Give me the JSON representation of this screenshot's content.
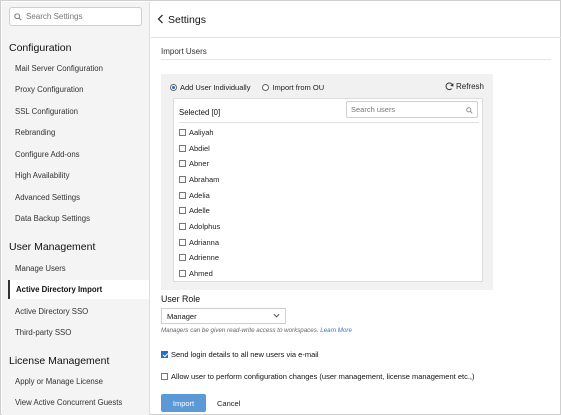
{
  "sidebar": {
    "search_placeholder": "Search Settings",
    "sections": [
      {
        "title": "Configuration",
        "items": [
          "Mail Server Configuration",
          "Proxy Configuration",
          "SSL Configuration",
          "Rebranding",
          "Configure Add-ons",
          "High Availability",
          "Advanced Settings",
          "Data Backup Settings"
        ]
      },
      {
        "title": "User Management",
        "items": [
          "Manage Users",
          "Active Directory Import",
          "Active Directory SSO",
          "Third-party SSO"
        ]
      },
      {
        "title": "License Management",
        "items": [
          "Apply or Manage License",
          "View Active Concurrent Guests"
        ]
      }
    ],
    "active_item": "Active Directory Import"
  },
  "header": {
    "back_icon": "chevron-left-icon",
    "title": "Settings"
  },
  "import": {
    "section_title": "Import Users",
    "radio_options": [
      "Add User Individually",
      "Import from OU"
    ],
    "selected_radio": "Add User Individually",
    "refresh_label": "Refresh",
    "selected_label": "Selected [0]",
    "user_search_placeholder": "Search users",
    "users": [
      "Aaliyah",
      "Abdiel",
      "Abner",
      "Abraham",
      "Adelia",
      "Adelle",
      "Adolphus",
      "Adrianna",
      "Adrienne",
      "Ahmed"
    ]
  },
  "role": {
    "label": "User Role",
    "value": "Manager",
    "hint": "Managers can be given read-write access to workspaces.",
    "hint_link": "Learn More"
  },
  "options": {
    "send_login": "Send login details to all new users via e-mail",
    "send_login_checked": true,
    "allow_config": "Allow user to perform configuration changes (user management, license management etc.,)",
    "allow_config_checked": false
  },
  "actions": {
    "import_label": "Import",
    "cancel_label": "Cancel"
  },
  "colors": {
    "accent": "#1e6fd0",
    "import_button": "#5b9ad6",
    "sidebar_bg": "#f4f4f4",
    "panel_bg": "#f1f1f1"
  }
}
